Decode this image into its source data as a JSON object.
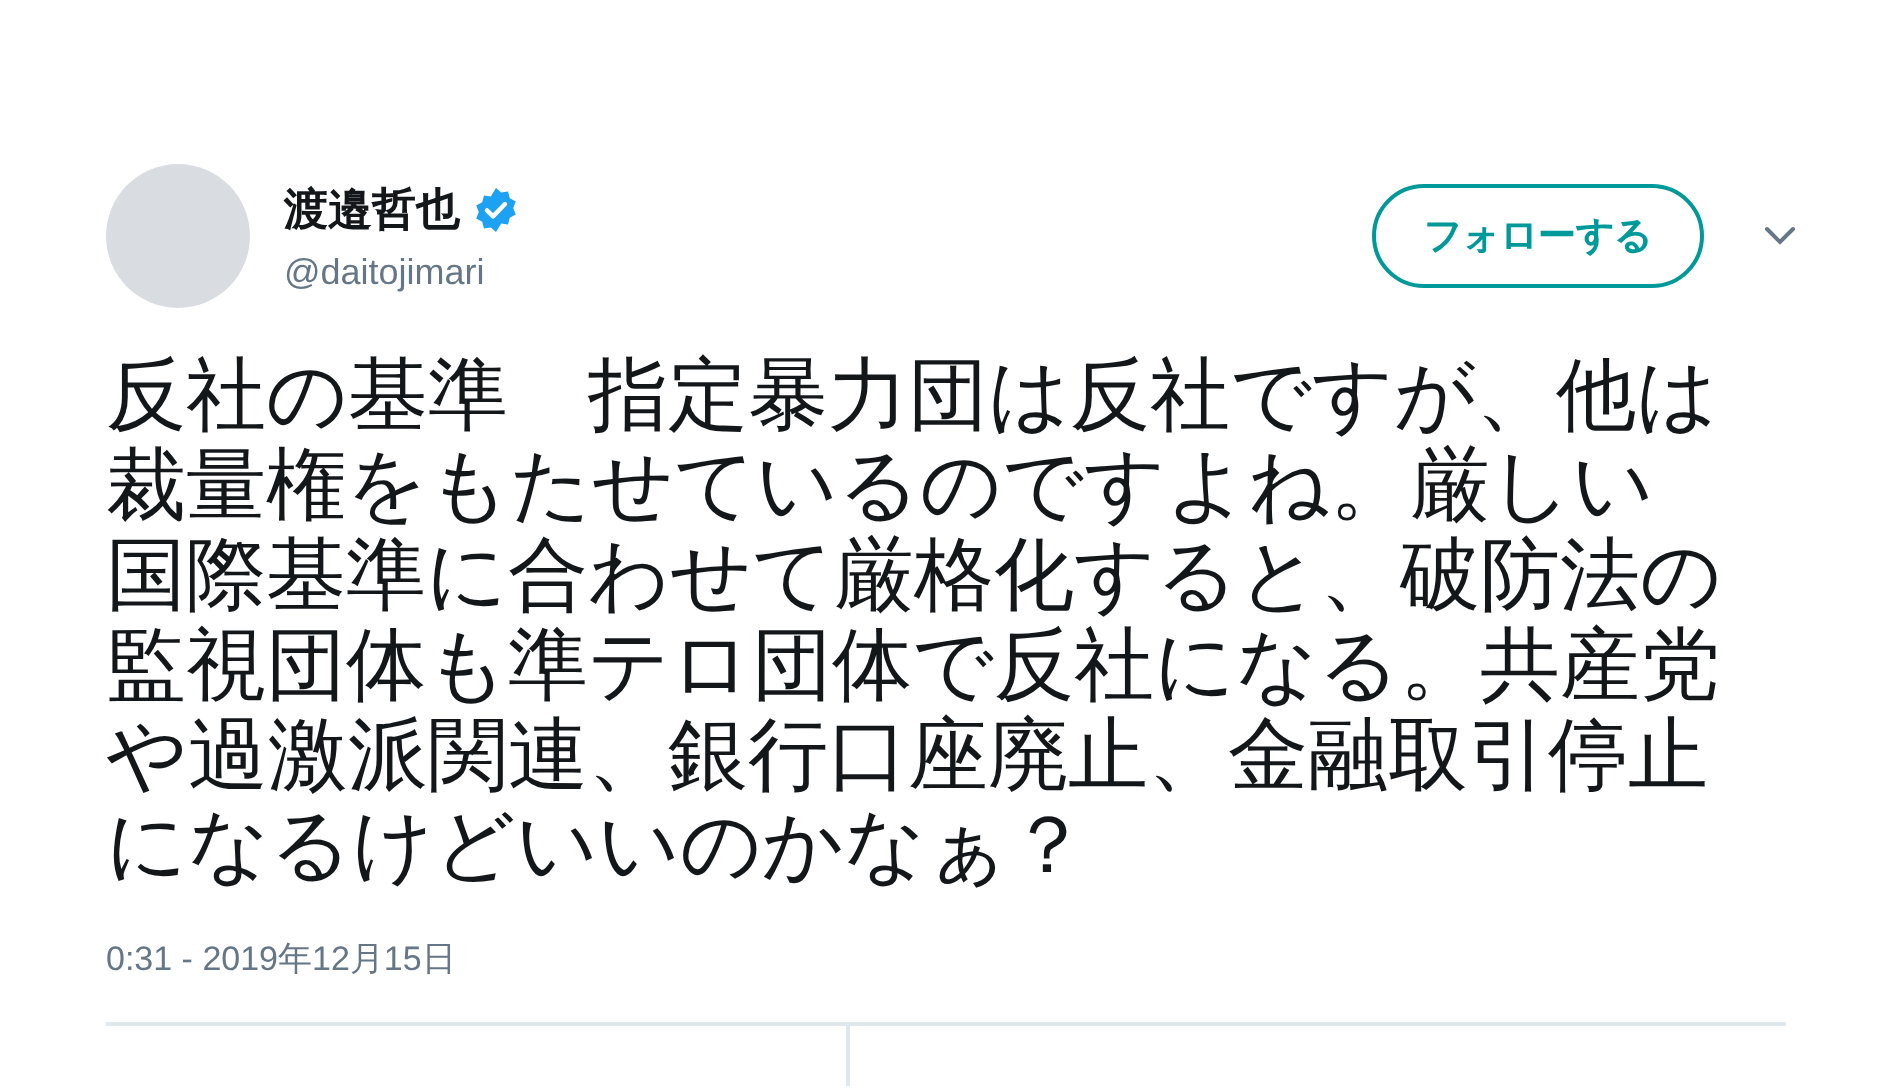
{
  "author": {
    "name": "渡邉哲也",
    "verified": true,
    "handle": "@daitojimari"
  },
  "follow_button": {
    "label": "フォローする"
  },
  "tweet": {
    "text": "反社の基準　指定暴力団は反社ですが、他は裁量権をもたせているのですよね。厳しい国際基準に合わせて厳格化すると、破防法の監視団体も準テロ団体で反社になる。共産党や過激派関連、銀行口座廃止、金融取引停止になるけどいいのかなぁ？",
    "timestamp": "0:31 - 2019年12月15日"
  }
}
